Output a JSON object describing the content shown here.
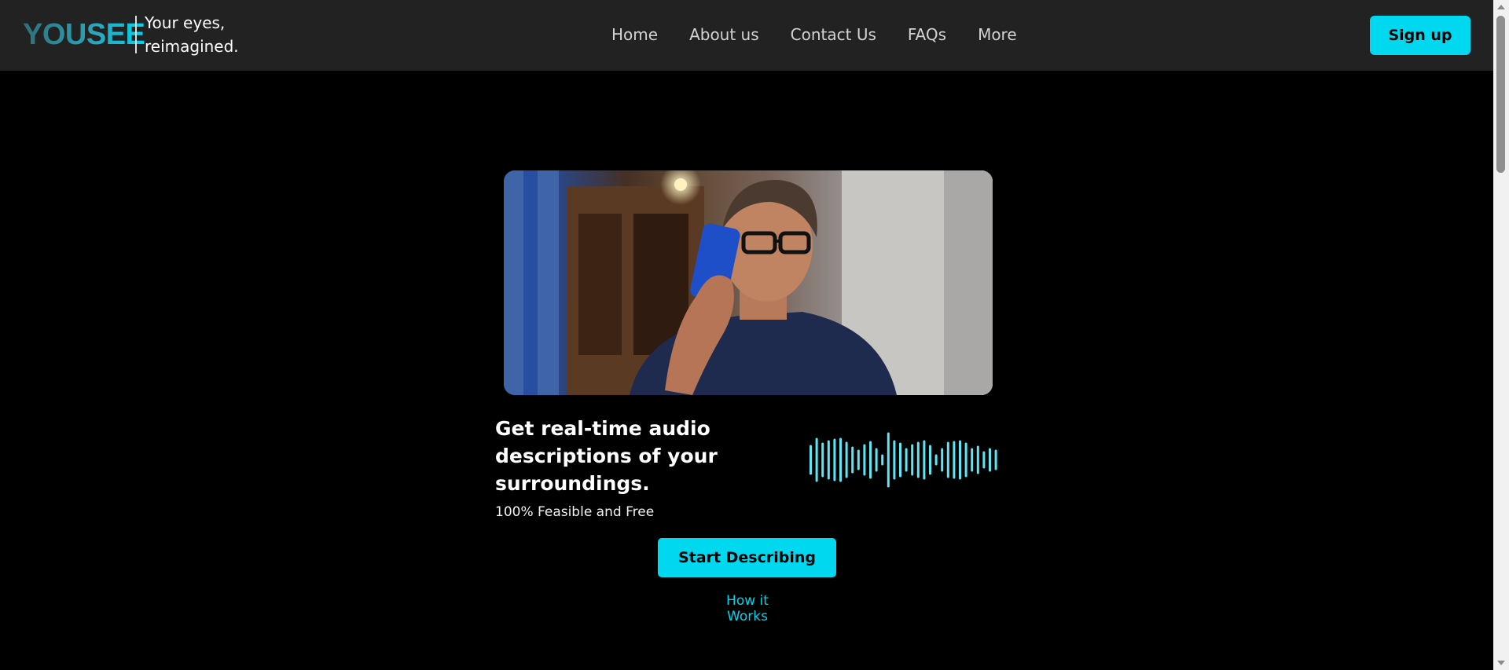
{
  "brand": {
    "logo": "YOUSEE",
    "tagline_line1": "Your eyes,",
    "tagline_line2": "reimagined."
  },
  "nav": {
    "items": [
      {
        "label": "Home"
      },
      {
        "label": "About us"
      },
      {
        "label": "Contact Us"
      },
      {
        "label": "FAQs"
      },
      {
        "label": "More"
      }
    ],
    "signup_label": "Sign up"
  },
  "hero": {
    "image_alt": "hero-photo",
    "headline": "Get real-time audio descriptions of your surroundings.",
    "subtext": "100% Feasible and Free",
    "cta_label": "Start Describing",
    "link_label": "How it Works",
    "waveform_icon": "audio-waveform-icon"
  },
  "colors": {
    "accent": "#00d8f0",
    "header_bg": "#222222",
    "page_bg": "#000000",
    "nav_text": "#d2d2d2"
  }
}
